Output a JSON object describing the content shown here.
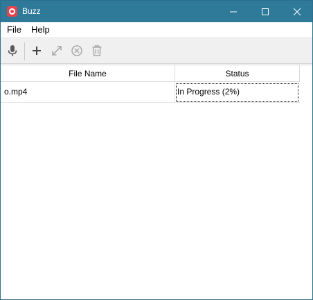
{
  "window": {
    "title": "Buzz",
    "controls": [
      "minimize",
      "maximize",
      "close"
    ]
  },
  "menu": {
    "file": "File",
    "help": "Help"
  },
  "toolbar": {
    "icons": [
      "microphone-icon",
      "plus-icon",
      "expand-icon",
      "cancel-circle-icon",
      "trash-icon"
    ]
  },
  "table": {
    "columns": [
      "File Name",
      "Status"
    ],
    "rows": [
      {
        "file_name": "o.mp4",
        "status": "In Progress (2%)",
        "progress_percent": 2
      }
    ]
  },
  "colors": {
    "titlebar": "#2f7a99",
    "app_icon": "#e8424a"
  }
}
